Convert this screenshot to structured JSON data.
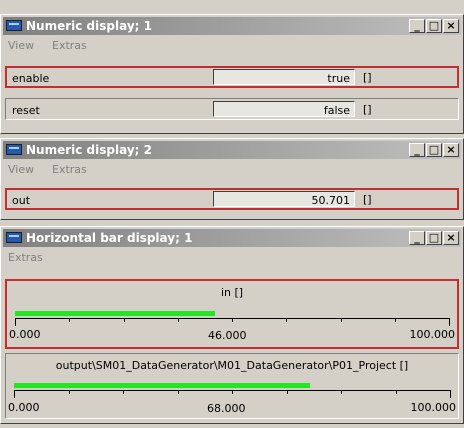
{
  "windows": [
    {
      "title": "Numeric display; 1",
      "menu": [
        "View",
        "Extras"
      ],
      "rows": [
        {
          "label": "enable",
          "value": "true",
          "unit": "[]"
        },
        {
          "label": "reset",
          "value": "false",
          "unit": "[]"
        }
      ]
    },
    {
      "title": "Numeric display; 2",
      "menu": [
        "View",
        "Extras"
      ],
      "rows": [
        {
          "label": "out",
          "value": "50.701",
          "unit": "[]"
        }
      ]
    },
    {
      "title": "Horizontal bar display; 1",
      "menu": [
        "Extras"
      ],
      "bars": [
        {
          "label": "in []",
          "min": "0.000",
          "max": "100.000",
          "current": "46.000",
          "fraction": 0.46
        },
        {
          "label": "output\\SM01_DataGenerator\\M01_DataGenerator\\P01_Project []",
          "min": "0.000",
          "max": "100.000",
          "current": "68.000",
          "fraction": 0.68
        }
      ]
    }
  ],
  "caption_buttons": [
    "_",
    "□",
    "×"
  ],
  "colors": {
    "fill": "#22e622",
    "selection_border": "#c03030",
    "titlebar_inactive": "#808080"
  }
}
